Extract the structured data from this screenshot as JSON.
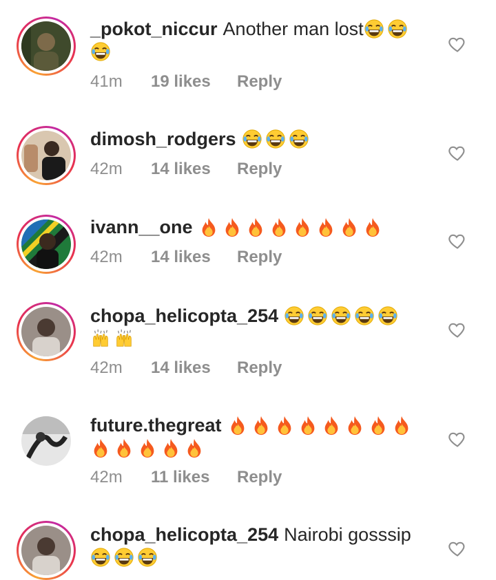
{
  "comments": [
    {
      "username": "_pokot_niccur",
      "text": "Another man lost",
      "emojis": [
        "joy-icon",
        "joy-icon",
        "joy-icon"
      ],
      "time": "41m",
      "likes": "19 likes",
      "reply": "Reply"
    },
    {
      "username": "dimosh_rodgers",
      "text": "",
      "emojis": [
        "joy-icon",
        "joy-icon",
        "joy-icon"
      ],
      "time": "42m",
      "likes": "14 likes",
      "reply": "Reply"
    },
    {
      "username": "ivann__one",
      "text": "",
      "emojis": [
        "fire-icon",
        "fire-icon",
        "fire-icon",
        "fire-icon",
        "fire-icon",
        "fire-icon",
        "fire-icon",
        "fire-icon"
      ],
      "time": "42m",
      "likes": "14 likes",
      "reply": "Reply"
    },
    {
      "username": "chopa_helicopta_254",
      "text": "",
      "emojis": [
        "joy-icon",
        "joy-icon",
        "joy-icon",
        "joy-icon",
        "joy-icon",
        "raising-hands-icon",
        "raising-hands-icon"
      ],
      "time": "42m",
      "likes": "14 likes",
      "reply": "Reply"
    },
    {
      "username": "future.thegreat",
      "text": "",
      "emojis": [
        "fire-icon",
        "fire-icon",
        "fire-icon",
        "fire-icon",
        "fire-icon",
        "fire-icon",
        "fire-icon",
        "fire-icon",
        "fire-icon",
        "fire-icon",
        "fire-icon",
        "fire-icon",
        "fire-icon"
      ],
      "time": "42m",
      "likes": "11 likes",
      "reply": "Reply"
    },
    {
      "username": "chopa_helicopta_254",
      "text": "Nairobi gosssip",
      "emojis": [
        "joy-icon",
        "joy-icon",
        "joy-icon"
      ],
      "time": "",
      "likes": "",
      "reply": ""
    }
  ],
  "colors": {
    "story_ring_start": "#f9a334",
    "story_ring_end": "#c32aa3",
    "meta_text": "#8e8e8e",
    "username_text": "#262626"
  }
}
